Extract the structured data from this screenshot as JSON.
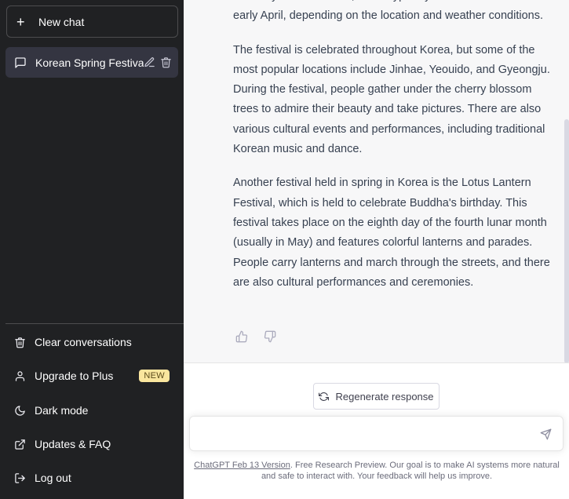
{
  "sidebar": {
    "new_chat_label": "New chat",
    "conversations": [
      {
        "title": "Korean Spring Festivals"
      }
    ],
    "menu": [
      {
        "label": "Clear conversations",
        "icon": "trash-icon"
      },
      {
        "label": "Upgrade to Plus",
        "icon": "user-icon",
        "badge": "NEW"
      },
      {
        "label": "Dark mode",
        "icon": "moon-icon"
      },
      {
        "label": "Updates & FAQ",
        "icon": "external-link-icon"
      },
      {
        "label": "Log out",
        "icon": "logout-icon"
      }
    ]
  },
  "chat": {
    "paragraphs": [
      "of cherry blossom trees, which typically occurs in late March or early April, depending on the location and weather conditions.",
      "The festival is celebrated throughout Korea, but some of the most popular locations include Jinhae, Yeouido, and Gyeongju. During the festival, people gather under the cherry blossom trees to admire their beauty and take pictures. There are also various cultural events and performances, including traditional Korean music and dance.",
      "Another festival held in spring in Korea is the Lotus Lantern Festival, which is held to celebrate Buddha's birthday. This festival takes place on the eighth day of the fourth lunar month (usually in May) and features colorful lanterns and parades. People carry lanterns and march through the streets, and there are also cultural performances and ceremonies."
    ],
    "regenerate_label": "Regenerate response",
    "input_placeholder": ""
  },
  "footer": {
    "version_link": "ChatGPT Feb 13 Version",
    "text": ". Free Research Preview. Our goal is to make AI systems more natural and safe to interact with. Your feedback will help us improve."
  },
  "colors": {
    "sidebar_bg": "#202123",
    "active_item_bg": "#343541",
    "message_bg": "#f7f7f8",
    "badge_bg": "#fae69e"
  }
}
